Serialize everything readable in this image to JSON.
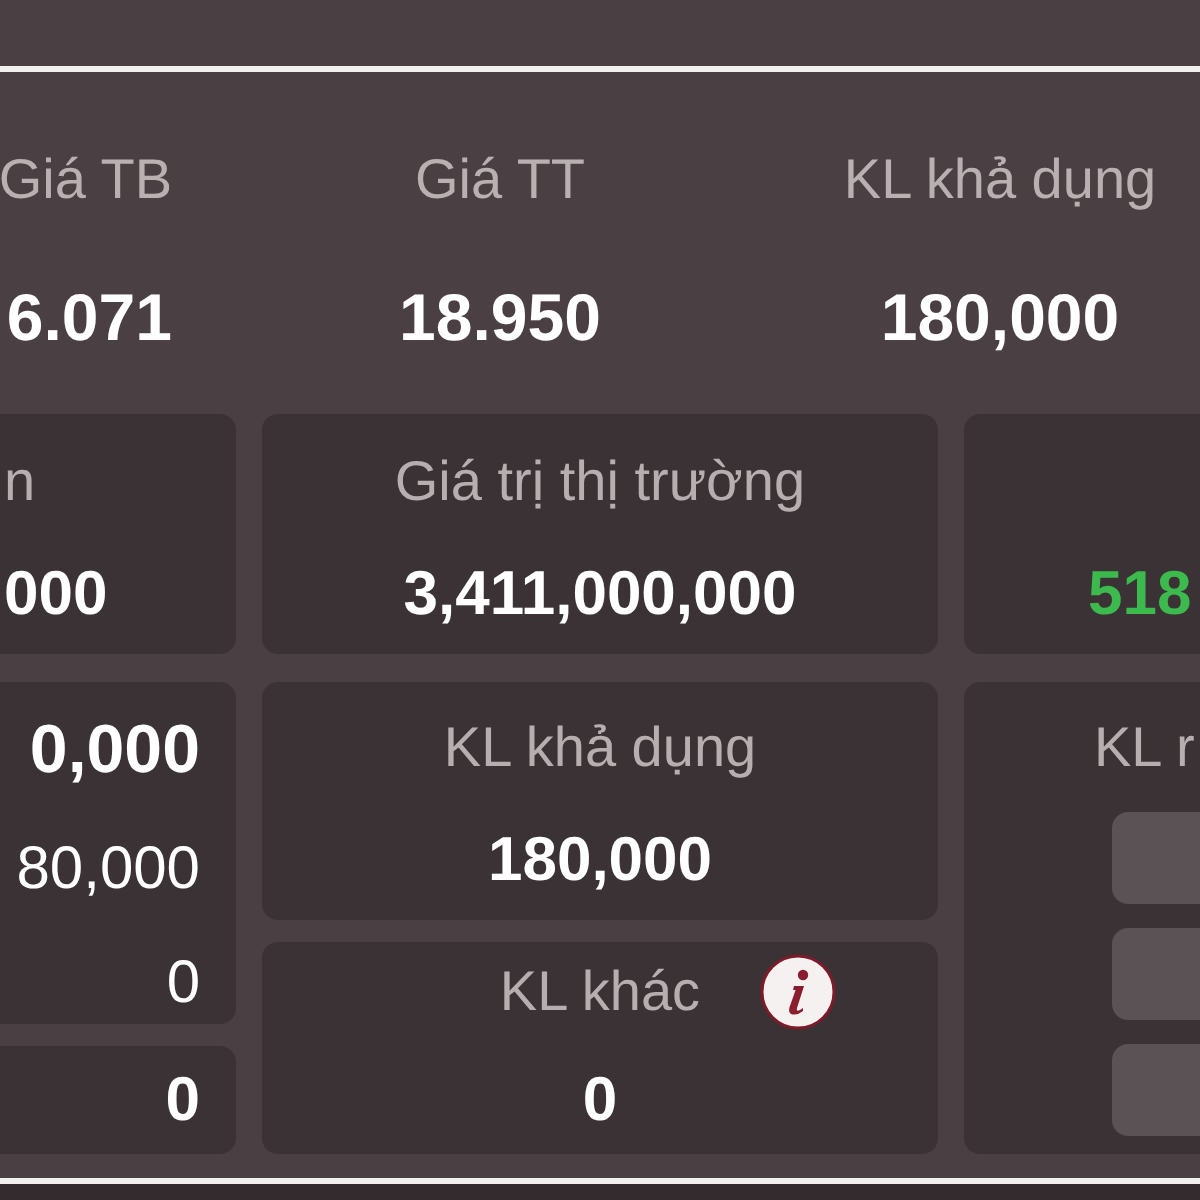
{
  "header": {
    "columns": [
      {
        "label": "Giá TB",
        "value": "6.071"
      },
      {
        "label": "Giá TT",
        "value": "18.950"
      },
      {
        "label": "KL khả dụng",
        "value": "180,000"
      }
    ]
  },
  "grid": {
    "columns": [
      {
        "cards": [
          {
            "kind": "stat",
            "label": "n",
            "value": "000"
          },
          {
            "kind": "multi",
            "values": [
              "0,000",
              "80,000",
              "0"
            ]
          },
          {
            "kind": "stat",
            "value": "0"
          }
        ]
      },
      {
        "cards": [
          {
            "kind": "stat",
            "label": "Giá trị thị trường",
            "value": "3,411,000,000"
          },
          {
            "kind": "stat",
            "label": "KL khả dụng",
            "value": "180,000"
          },
          {
            "kind": "info",
            "label": "KL khác",
            "value": "0"
          }
        ]
      },
      {
        "cards": [
          {
            "kind": "stat",
            "value": "518",
            "color": "#3dba4e"
          },
          {
            "kind": "actions",
            "label": "KL r"
          }
        ]
      }
    ]
  }
}
